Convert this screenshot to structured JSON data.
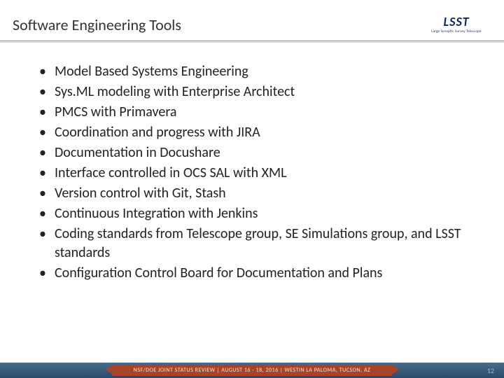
{
  "header": {
    "title": "Software Engineering Tools",
    "logo": {
      "main": "LSST",
      "sub": "Large Synoptic Survey Telescope"
    }
  },
  "bullets": [
    "Model Based Systems Engineering",
    "Sys.ML modeling with Enterprise Architect",
    "PMCS with Primavera",
    "Coordination and progress with JIRA",
    "Documentation in Docushare",
    "Interface controlled in OCS SAL with XML",
    "Version control with Git, Stash",
    "Continuous Integration with Jenkins",
    "Coding  standards from Telescope group, SE Simulations group, and LSST standards",
    "Configuration Control Board for Documentation and Plans"
  ],
  "footer": {
    "ribbon": "NSF/DOE JOINT STATUS REVIEW  |  AUGUST 16 - 18, 2016  |  WESTIN LA PALOMA, TUCSON, AZ",
    "page_number": "12"
  }
}
